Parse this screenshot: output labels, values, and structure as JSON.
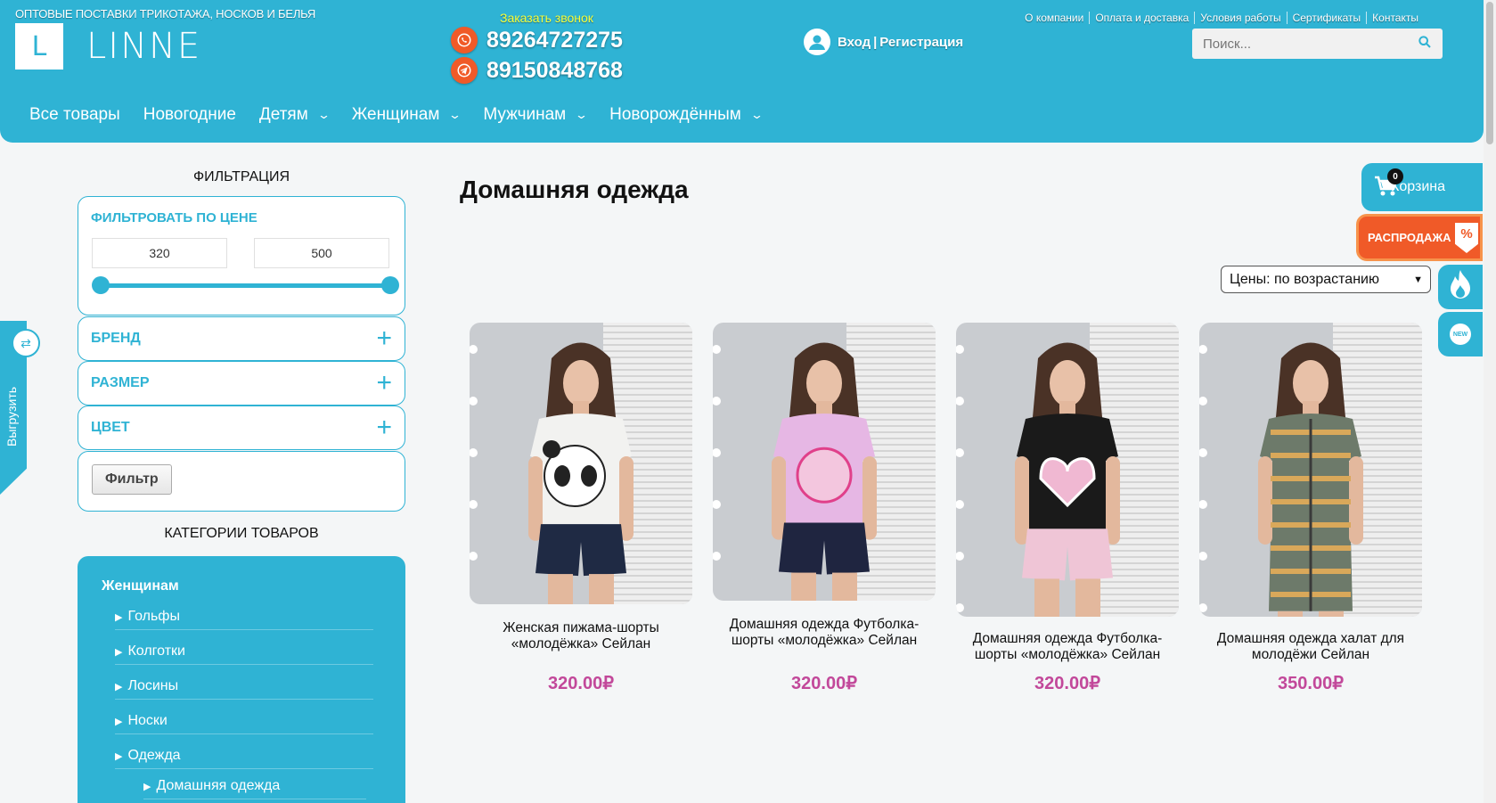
{
  "header": {
    "tagline": "ОПТОВЫЕ ПОСТАВКИ ТРИКОТАЖА, НОСКОВ И БЕЛЬЯ",
    "logo_letter": "L",
    "logo_text": "LINNE",
    "callback": "Заказать звонок",
    "phone_whatsapp": "89264727275",
    "phone_telegram": "89150848768",
    "login": "Вход",
    "register": "Регистрация",
    "login_sep": "|",
    "top_links": [
      "О компании",
      "Оплата и доставка",
      "Условия работы",
      "Сертификаты",
      "Контакты"
    ],
    "search_placeholder": "Поиск..."
  },
  "nav": {
    "items": [
      {
        "label": "Все товары",
        "dropdown": false
      },
      {
        "label": "Новогодние",
        "dropdown": false
      },
      {
        "label": "Детям",
        "dropdown": true
      },
      {
        "label": "Женщинам",
        "dropdown": true
      },
      {
        "label": "Мужчинам",
        "dropdown": true
      },
      {
        "label": "Новорождённым",
        "dropdown": true
      }
    ]
  },
  "export_tab": {
    "label": "Выгрузить"
  },
  "sidebar": {
    "filter_title": "ФИЛЬТРАЦИЯ",
    "price_title": "ФИЛЬТРОВАТЬ ПО ЦЕНЕ",
    "price_min": "320",
    "price_max": "500",
    "accordions": [
      "БРЕНД",
      "РАЗМЕР",
      "ЦВЕТ"
    ],
    "filter_button": "Фильтр",
    "categories_title": "КАТЕГОРИИ ТОВАРОВ",
    "category_root": "Женщинам",
    "categories": [
      "Гольфы",
      "Колготки",
      "Лосины",
      "Носки",
      "Одежда"
    ],
    "subcategory": "Домашняя одежда"
  },
  "main": {
    "title": "Домашняя одежда",
    "sort_selected": "Цены: по возрастанию",
    "products": [
      {
        "name": "Женская пижама-шорты «молодёжка» Сейлан",
        "price": "320.00₽",
        "shirt": "#f2f2f0",
        "shorts": "#1f2a44",
        "print": "panda"
      },
      {
        "name": "Домашняя одежда Футболка-шорты «молодёжка» Сейлан",
        "price": "320.00₽",
        "shirt": "#e6b7e4",
        "shorts": "#1f2540",
        "print": "sun"
      },
      {
        "name": "Домашняя одежда Футболка-шорты «молодёжка» Сейлан",
        "price": "320.00₽",
        "shirt": "#1a1a1a",
        "shorts": "#efc5d6",
        "print": "heart"
      },
      {
        "name": "Домашняя одежда халат для молодёжи Сейлан",
        "price": "350.00₽",
        "shirt": "#6d7a6a",
        "shorts": "#6d7a6a",
        "print": "robe"
      }
    ]
  },
  "floating": {
    "cart_count": "0",
    "cart_label": "Корзина",
    "sale_label": "РАСПРОДАЖА",
    "sale_icon": "%",
    "new_label": "NEW"
  },
  "colors": {
    "accent": "#2fb3d4",
    "price": "#c2489a",
    "sale": "#f05a28",
    "callback": "#f6ff3a"
  }
}
